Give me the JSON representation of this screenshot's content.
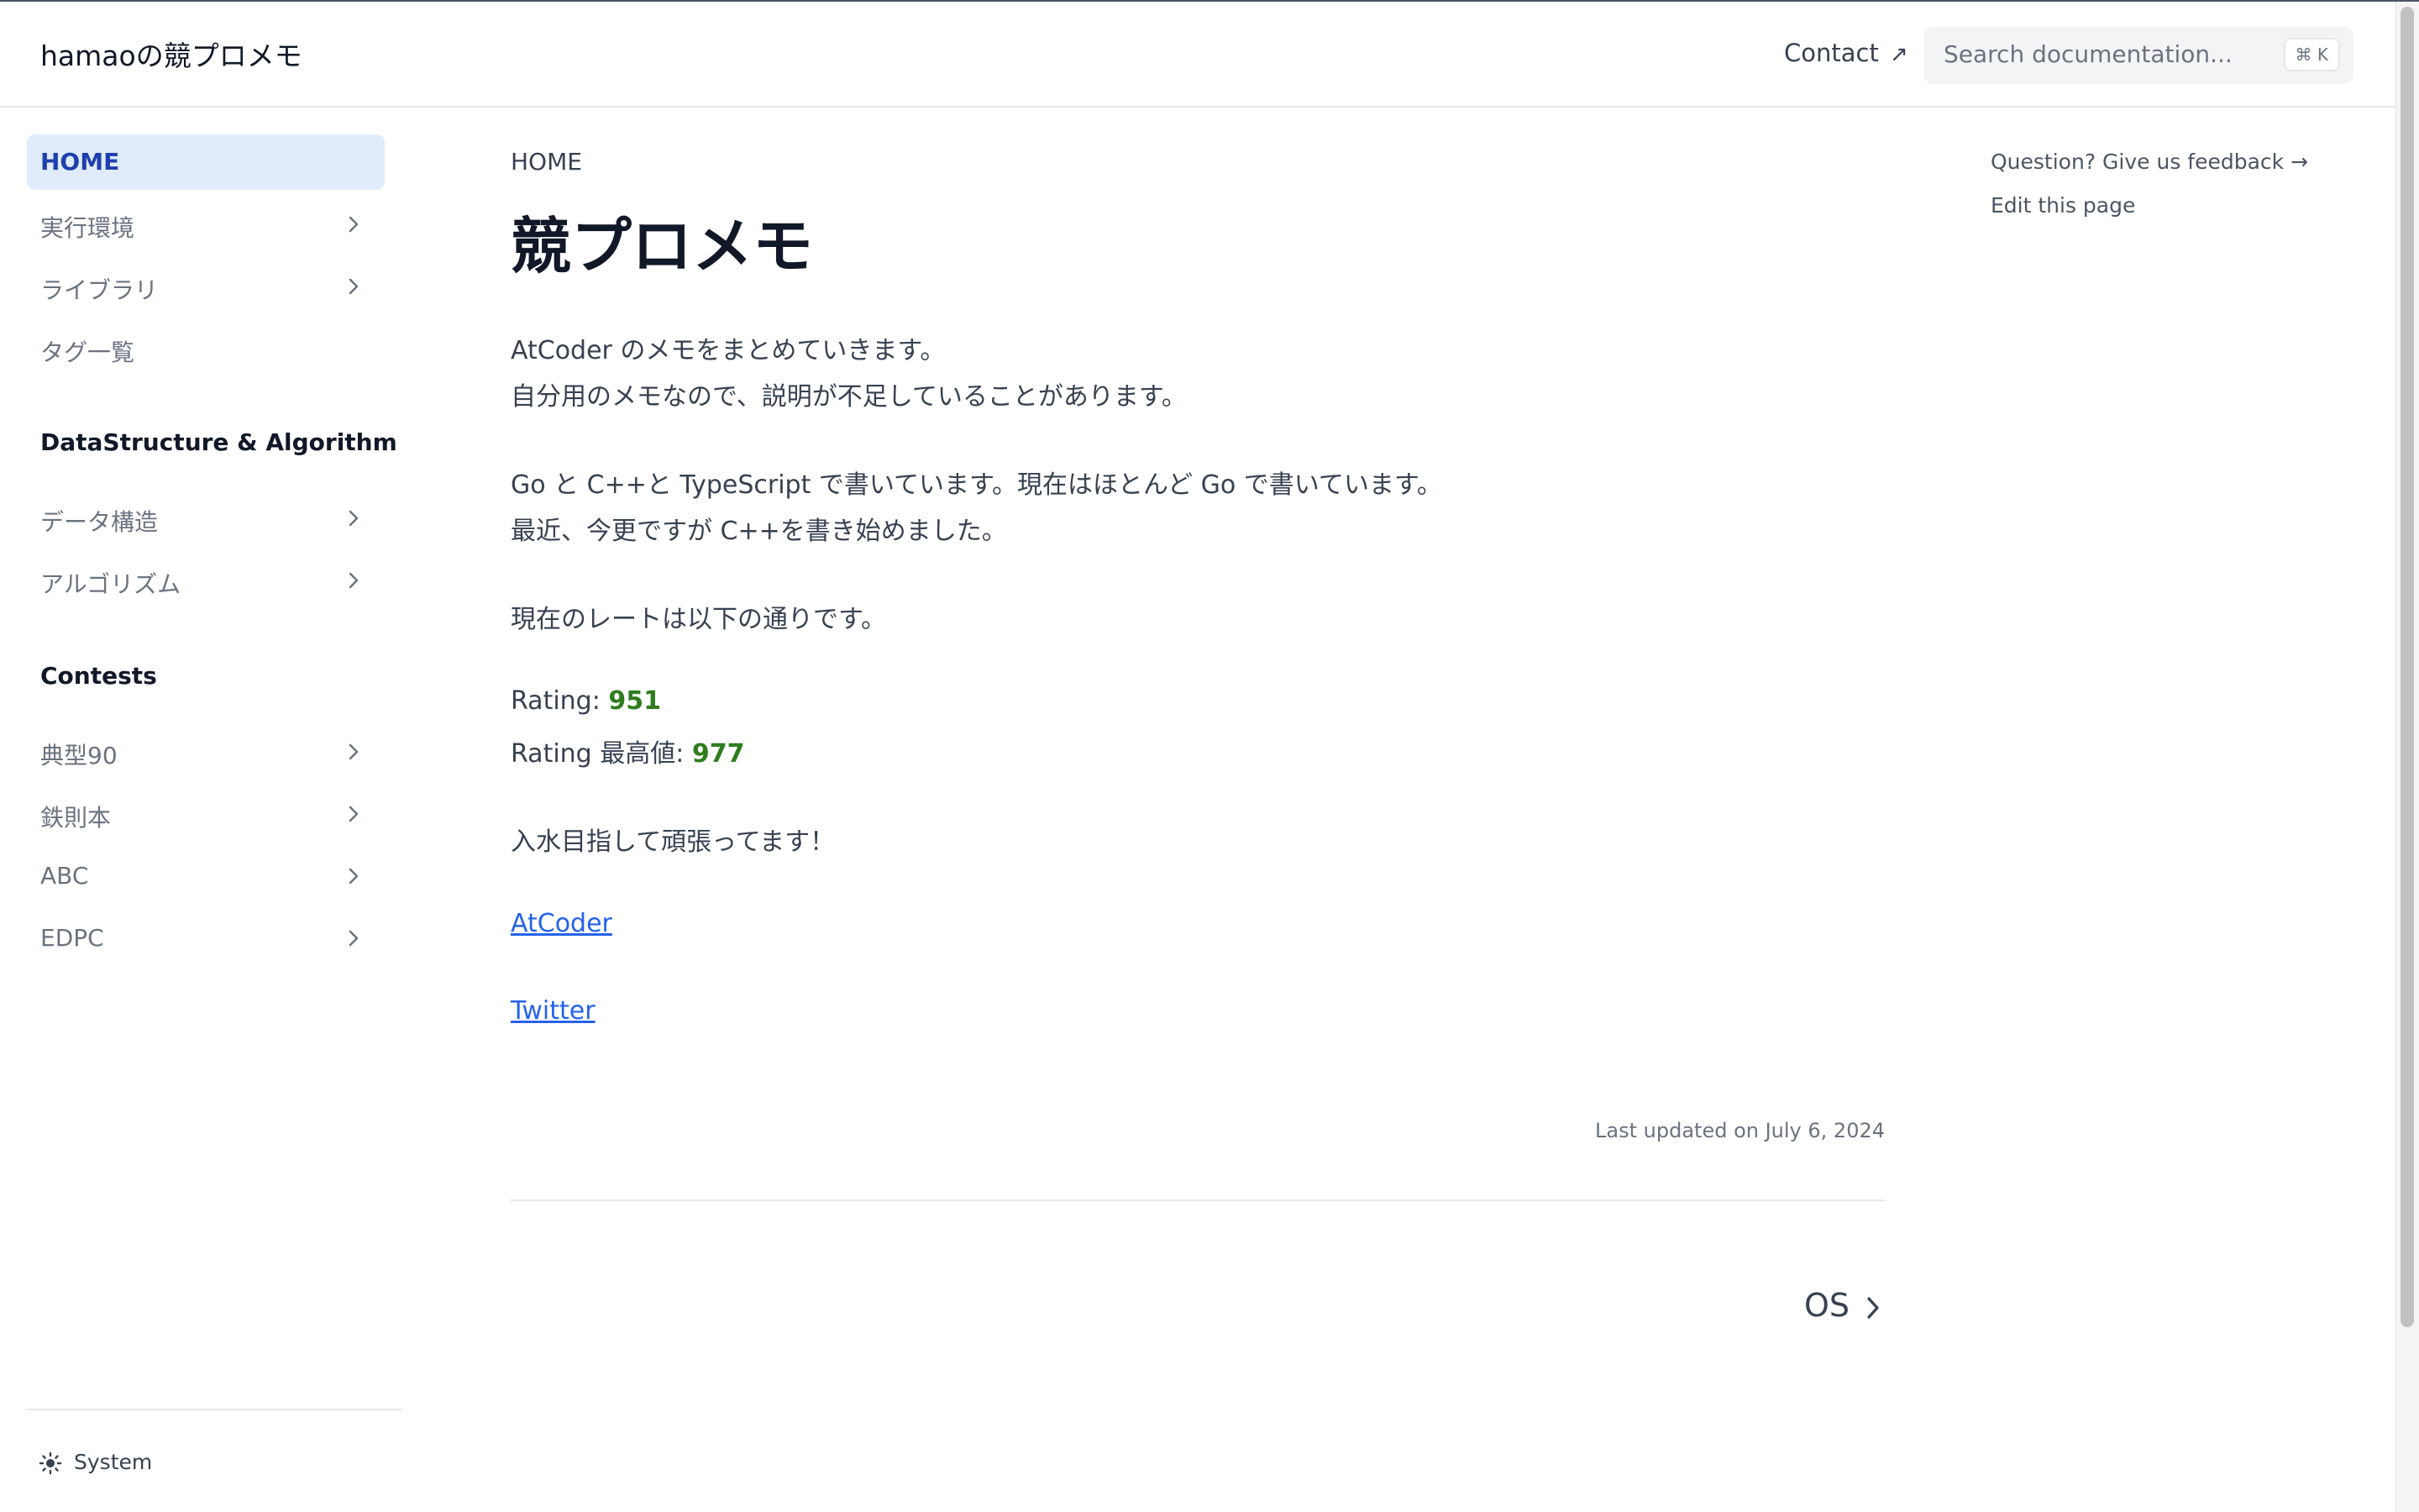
{
  "header": {
    "logo": "hamaoの競プロメモ",
    "contact_label": "Contact",
    "contact_icon": "external-arrow-icon",
    "search_placeholder": "Search documentation...",
    "search_shortcut": "⌘ K"
  },
  "sidebar": {
    "top_items": [
      {
        "label": "HOME",
        "active": true,
        "expandable": false
      },
      {
        "label": "実行環境",
        "expandable": true
      },
      {
        "label": "ライブラリ",
        "expandable": true
      },
      {
        "label": "タグ一覧",
        "expandable": false
      }
    ],
    "sections": [
      {
        "title": "DataStructure & Algorithm",
        "items": [
          {
            "label": "データ構造",
            "expandable": true
          },
          {
            "label": "アルゴリズム",
            "expandable": true
          }
        ]
      },
      {
        "title": "Contests",
        "items": [
          {
            "label": "典型90",
            "expandable": true
          },
          {
            "label": "鉄則本",
            "expandable": true
          },
          {
            "label": "ABC",
            "expandable": true
          },
          {
            "label": "EDPC",
            "expandable": true
          }
        ]
      }
    ],
    "theme_label": "System",
    "theme_icon": "sun-icon"
  },
  "main": {
    "breadcrumb": "HOME",
    "title": "競プロメモ",
    "paragraphs": [
      "AtCoder のメモをまとめていきます。",
      "自分用のメモなので、説明が不足していることがあります。",
      "Go と C++と TypeScript で書いています。現在はほとんど Go で書いています。",
      "最近、今更ですが C++を書き始めました。",
      "現在のレートは以下の通りです。"
    ],
    "rating_label": "Rating: ",
    "rating_value": "951",
    "max_rating_label": "Rating 最高値: ",
    "max_rating_value": "977",
    "closing": "入水目指して頑張ってます！",
    "links": [
      "AtCoder",
      "Twitter"
    ],
    "last_updated": "Last updated on July 6, 2024",
    "next_label": "OS"
  },
  "toc": {
    "feedback": "Question? Give us feedback →",
    "edit": "Edit this page"
  },
  "colors": {
    "accent": "#1e40af",
    "active_bg": "#e0ecfb",
    "rating_green": "#2f7d1e",
    "link": "#2563eb"
  }
}
